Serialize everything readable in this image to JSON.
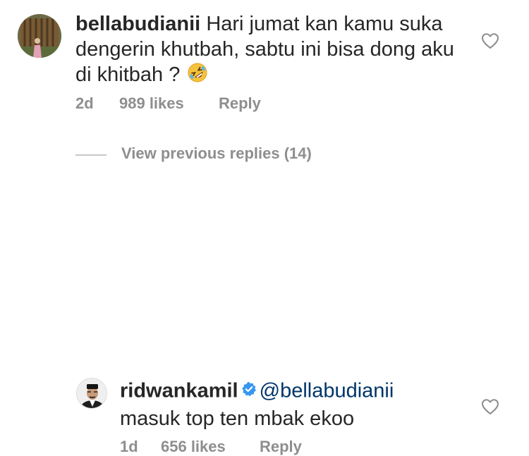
{
  "comments": [
    {
      "username": "bellabudianii",
      "text": "Hari jumat kan kamu suka dengerin khutbah, sabtu ini bisa dong aku di khitbah ?",
      "emoji": "rolling-on-the-floor-laughing-emoji",
      "time": "2d",
      "likes": "989 likes",
      "reply_label": "Reply"
    },
    {
      "username": "ridwankamil",
      "verified": true,
      "mention": "@bellabudianii",
      "text": "masuk top ten mbak ekoo",
      "time": "1d",
      "likes": "656 likes",
      "reply_label": "Reply"
    }
  ],
  "view_replies": {
    "label": "View previous replies (14)"
  },
  "icons": {
    "like": "heart-outline-icon",
    "verified": "verified-badge-icon"
  },
  "colors": {
    "text": "#262626",
    "secondary": "#8e8e8e",
    "mention": "#003569",
    "verified": "#3897f0"
  }
}
